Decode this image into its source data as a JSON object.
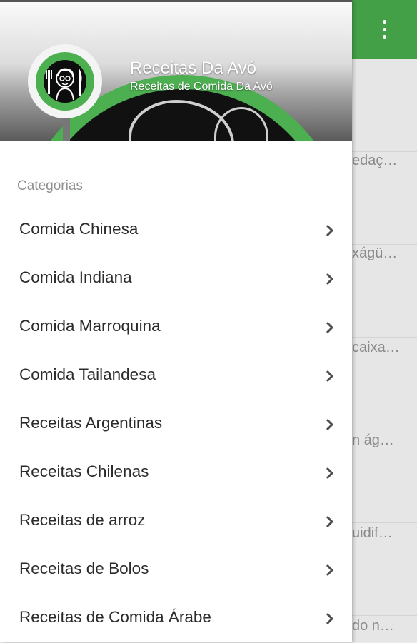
{
  "app_bar": {
    "overflow_icon": "more-vert-icon",
    "color": "#43a047"
  },
  "background_snippets": [
    "edaç…",
    "xágü…",
    "caixa…",
    "n ág…",
    "uidif…",
    "do n…"
  ],
  "drawer": {
    "title": "Receitas Da Avó",
    "subtitle": "Receitas de Comida Da Avó",
    "section_label": "Categorias",
    "chevron_icon": "chevron-right-icon",
    "items": [
      {
        "label": "Comida Chinesa"
      },
      {
        "label": "Comida Indiana"
      },
      {
        "label": "Comida Marroquina"
      },
      {
        "label": "Comida Tailandesa"
      },
      {
        "label": "Receitas Argentinas"
      },
      {
        "label": "Receitas Chilenas"
      },
      {
        "label": "Receitas de arroz"
      },
      {
        "label": "Receitas de Bolos"
      },
      {
        "label": "Receitas de Comida Árabe"
      }
    ]
  }
}
